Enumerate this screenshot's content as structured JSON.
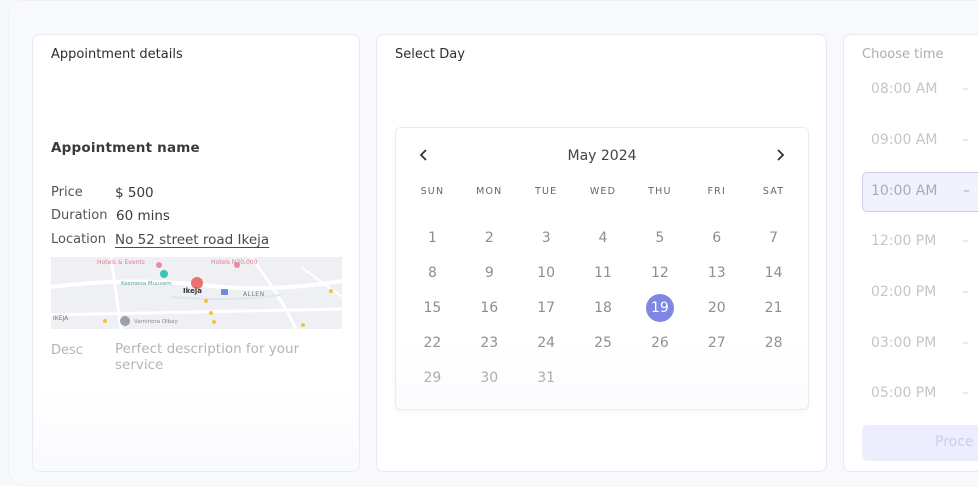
{
  "details": {
    "title": "Appointment details",
    "name": "Appointment name",
    "price_label": "Price",
    "price_value": "$ 500",
    "duration_label": "Duration",
    "duration_value": "60 mins",
    "location_label": "Location",
    "location_value": "No 52 street road Ikeja",
    "map_labels": {
      "hotel1": "Hotels & Events",
      "hotel2": "Hotels N30,000",
      "place1": "Kosmona Muuvem",
      "city": "Ikeja",
      "city_upper": "IKEJA",
      "street": "ALLEN",
      "place2": "Vaminora Olbay"
    },
    "desc_label": "Desc",
    "desc_value": "Perfect description for your service"
  },
  "calendar": {
    "title": "Select Day",
    "month": "May 2024",
    "prev_icon": "chevron-left",
    "next_icon": "chevron-right",
    "weekdays": [
      "SUN",
      "MON",
      "TUE",
      "WED",
      "THU",
      "FRI",
      "SAT"
    ],
    "weeks": [
      [
        "1",
        "2",
        "3",
        "4",
        "5",
        "6",
        "7"
      ],
      [
        "8",
        "9",
        "10",
        "11",
        "12",
        "13",
        "14"
      ],
      [
        "15",
        "16",
        "17",
        "18",
        "19",
        "20",
        "21"
      ],
      [
        "22",
        "23",
        "24",
        "25",
        "26",
        "27",
        "28"
      ],
      [
        "29",
        "30",
        "31",
        "",
        "",
        "",
        ""
      ]
    ],
    "selected": "19",
    "accent_color": "#7f87e4"
  },
  "time": {
    "title": "Choose time",
    "slots": [
      "08:00 AM",
      "09:00 AM",
      "10:00 AM",
      "12:00 PM",
      "02:00 PM",
      "03:00 PM",
      "05:00 PM"
    ],
    "separator": "–",
    "selected": "10:00 AM",
    "proceed_label": "Proce"
  }
}
